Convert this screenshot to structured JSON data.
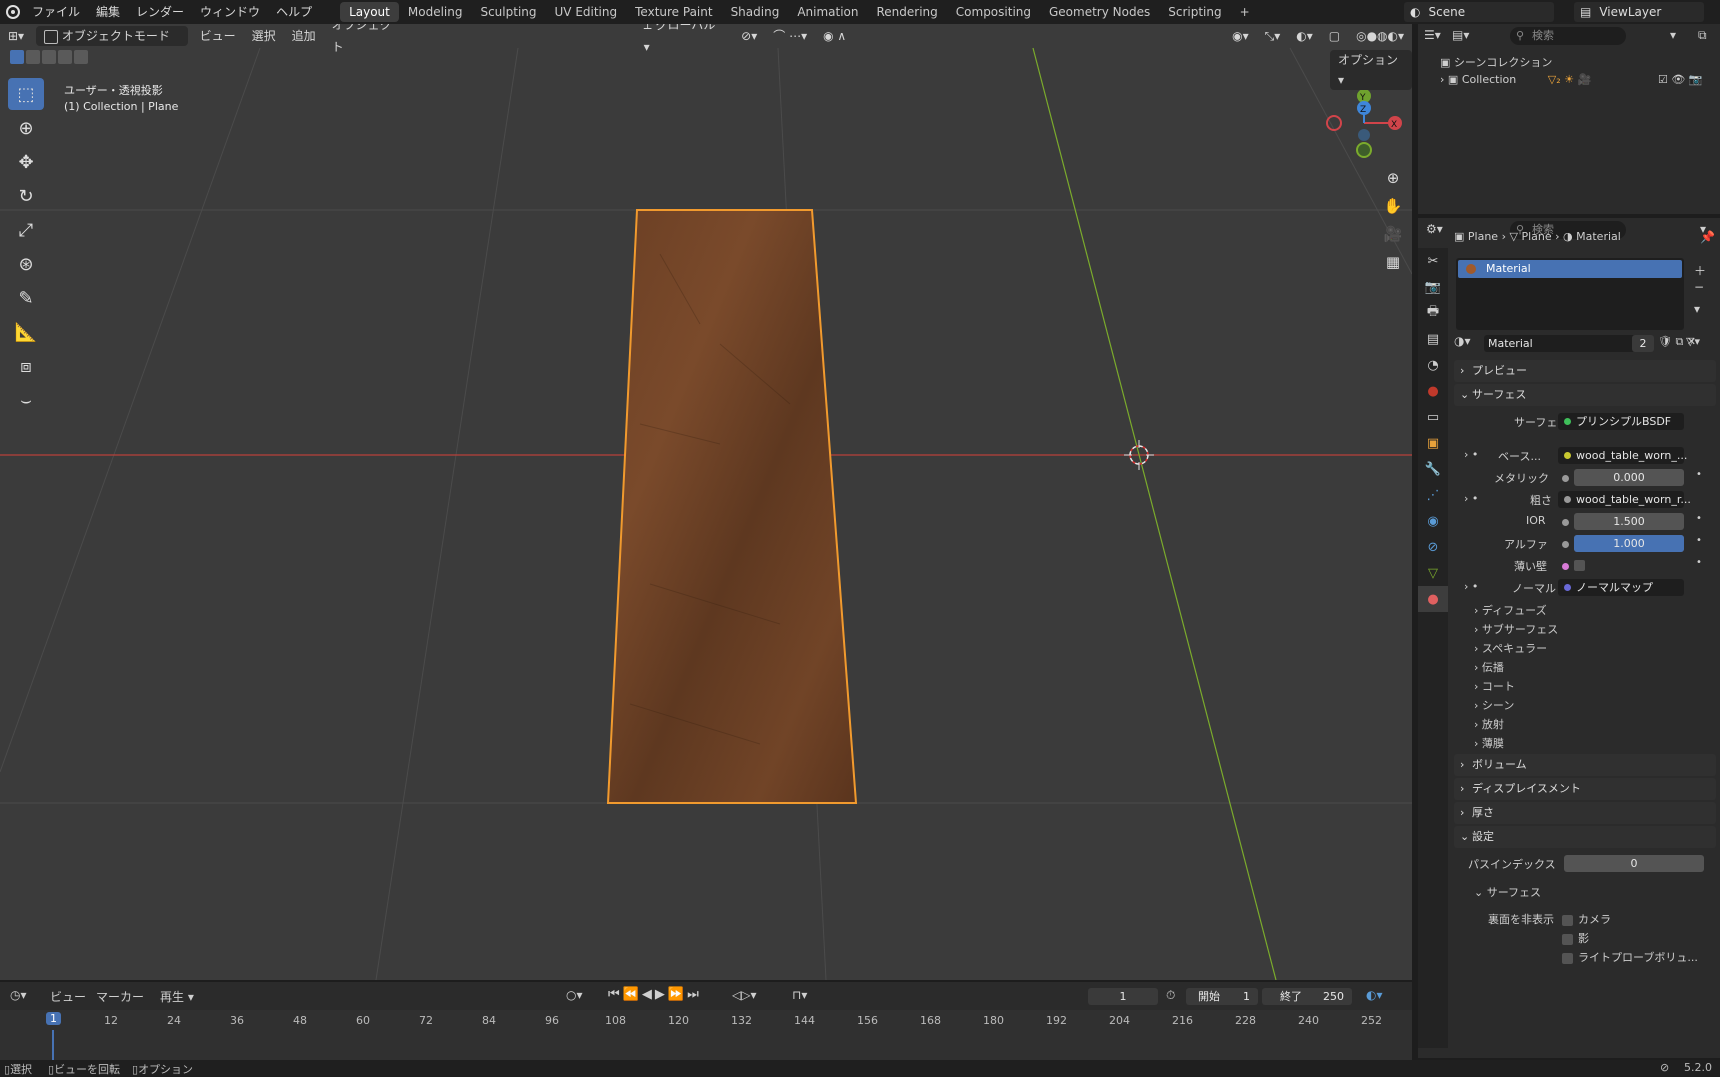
{
  "menu": [
    "ファイル",
    "編集",
    "レンダー",
    "ウィンドウ",
    "ヘルプ"
  ],
  "workspaces": [
    {
      "label": "Layout",
      "active": true
    },
    {
      "label": "Modeling"
    },
    {
      "label": "Sculpting"
    },
    {
      "label": "UV Editing"
    },
    {
      "label": "Texture Paint"
    },
    {
      "label": "Shading"
    },
    {
      "label": "Animation"
    },
    {
      "label": "Rendering"
    },
    {
      "label": "Compositing"
    },
    {
      "label": "Geometry Nodes"
    },
    {
      "label": "Scripting"
    }
  ],
  "add_workspace": "+",
  "scene": {
    "name": "Scene",
    "view_layer": "ViewLayer"
  },
  "viewport": {
    "mode": "オブジェクトモード",
    "menus": [
      "ビュー",
      "選択",
      "追加",
      "オブジェクト"
    ],
    "transform_orientation": "グローバル",
    "options": "オプション",
    "overlay_line1": "ユーザー・透視投影",
    "overlay_line2": "(1) Collection | Plane",
    "gizmo_axes": {
      "y": "Y",
      "z": "Z",
      "x": "X"
    }
  },
  "outliner": {
    "search_placeholder": "検索",
    "root": "シーンコレクション",
    "collection": "Collection"
  },
  "properties": {
    "search_placeholder": "検索",
    "breadcrumb": [
      "Plane",
      "Plane",
      "Material"
    ],
    "material_slot": "Material",
    "material_name": "Material",
    "material_users": "2",
    "panels": {
      "preview": "プレビュー",
      "surface": "サーフェス",
      "volume": "ボリューム",
      "displacement": "ディスプレイスメント",
      "thickness": "厚さ",
      "settings": "設定"
    },
    "surface_label": "サーフェス",
    "surface_value": "プリンシプルBSDF",
    "base_label": "ベース...",
    "base_value": "wood_table_worn_...",
    "metallic_label": "メタリック",
    "metallic_value": "0.000",
    "roughness_label": "粗さ",
    "roughness_value": "wood_table_worn_r...",
    "ior_label": "IOR",
    "ior_value": "1.500",
    "alpha_label": "アルファ",
    "alpha_value": "1.000",
    "alpha_fraction": 1.0,
    "thin_wall_label": "薄い壁",
    "normal_label": "ノーマル",
    "normal_value": "ノーマルマップ",
    "subpanels": [
      "ディフューズ",
      "サブサーフェス",
      "スペキュラー",
      "伝播",
      "コート",
      "シーン",
      "放射",
      "薄膜"
    ],
    "pass_index_label": "パスインデックス",
    "pass_index_value": "0",
    "settings_surface": "サーフェス",
    "backface_label": "裏面を非表示",
    "backface_options": [
      "カメラ",
      "影",
      "ライトプローブボリュ..."
    ]
  },
  "timeline": {
    "menus": [
      "ビュー",
      "マーカー",
      "再生"
    ],
    "current_frame": "1",
    "start_label": "開始",
    "start_value": "1",
    "end_label": "終了",
    "end_value": "250",
    "ticks": [
      "1",
      "12",
      "24",
      "36",
      "48",
      "60",
      "72",
      "84",
      "96",
      "108",
      "120",
      "132",
      "144",
      "156",
      "168",
      "180",
      "192",
      "204",
      "216",
      "228",
      "240",
      "252"
    ]
  },
  "status": {
    "items": [
      "選択",
      "ビューを回転",
      "オプション"
    ],
    "version": "5.2.0"
  },
  "colors": {
    "accent": "#4772b3",
    "selection": "#f19a2e",
    "x_axis": "#b8413b",
    "y_axis": "#7bab2c"
  }
}
